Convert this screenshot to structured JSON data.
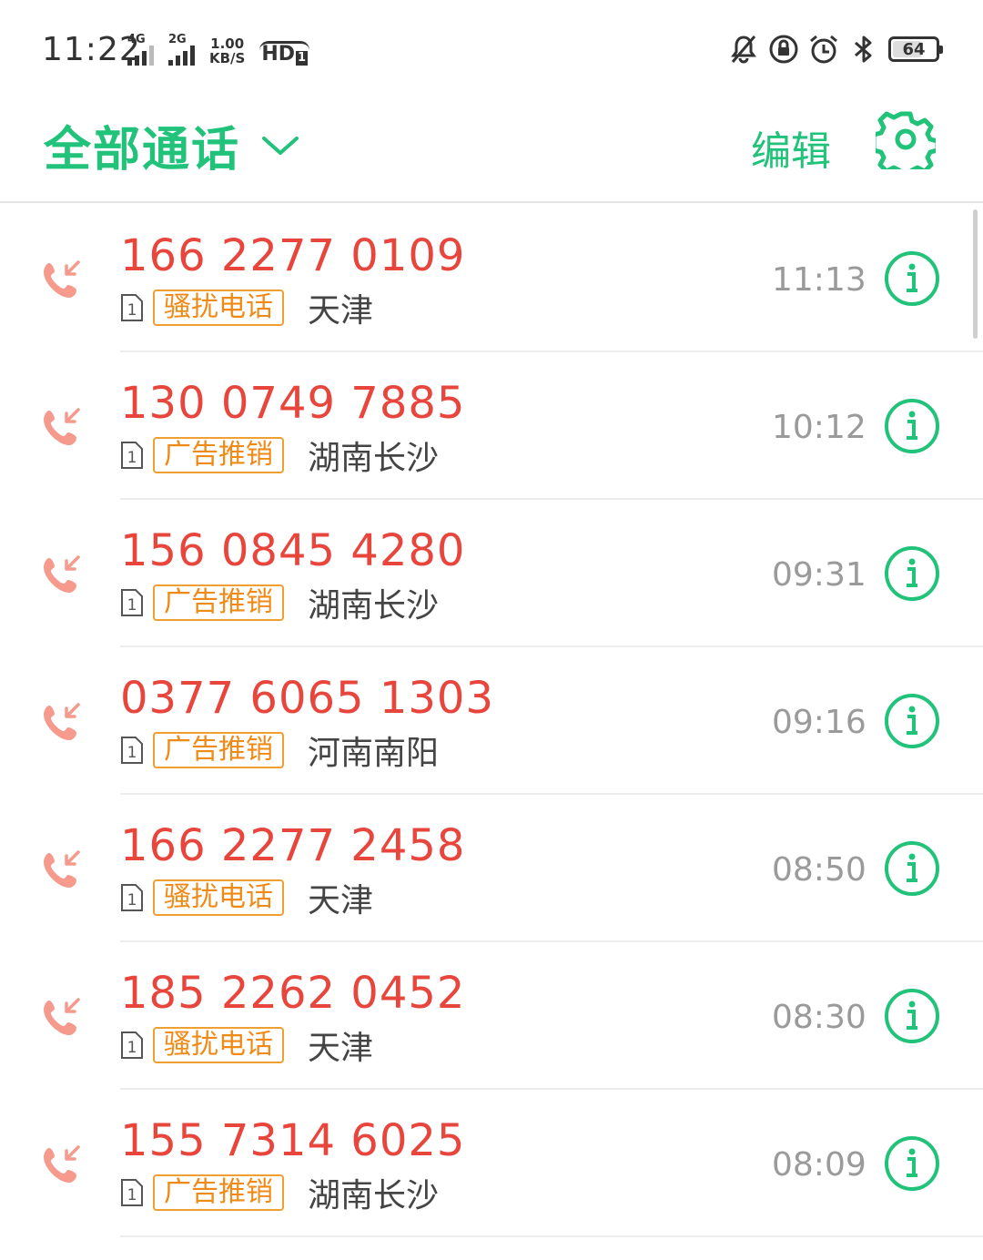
{
  "status_bar": {
    "time": "11:22",
    "sim1_network": "4G",
    "sim2_network": "2G",
    "speed_value": "1.00",
    "speed_unit": "KB/S",
    "hd_label": "HD",
    "hd_sub": "1",
    "battery_level": "64",
    "icons": [
      "mute-icon",
      "rotation-lock-icon",
      "alarm-icon",
      "bluetooth-icon",
      "battery-icon"
    ]
  },
  "header": {
    "title": "全部通话",
    "edit_label": "编辑",
    "title_icon": "chevron-down-icon",
    "settings_icon": "gear-icon"
  },
  "colors": {
    "accent": "#21c27a",
    "missed_number": "#e8453c",
    "tag": "#ef8a17",
    "call_icon": "#f59a8d"
  },
  "calls": [
    {
      "number": "166 2277 0109",
      "sim": "1",
      "tag": "骚扰电话",
      "location": "天津",
      "time": "11:13"
    },
    {
      "number": "130 0749 7885",
      "sim": "1",
      "tag": "广告推销",
      "location": "湖南长沙",
      "time": "10:12"
    },
    {
      "number": "156 0845 4280",
      "sim": "1",
      "tag": "广告推销",
      "location": "湖南长沙",
      "time": "09:31"
    },
    {
      "number": "0377 6065 1303",
      "sim": "1",
      "tag": "广告推销",
      "location": "河南南阳",
      "time": "09:16"
    },
    {
      "number": "166 2277 2458",
      "sim": "1",
      "tag": "骚扰电话",
      "location": "天津",
      "time": "08:50"
    },
    {
      "number": "185 2262 0452",
      "sim": "1",
      "tag": "骚扰电话",
      "location": "天津",
      "time": "08:30"
    },
    {
      "number": "155 7314 6025",
      "sim": "1",
      "tag": "广告推销",
      "location": "湖南长沙",
      "time": "08:09"
    }
  ]
}
